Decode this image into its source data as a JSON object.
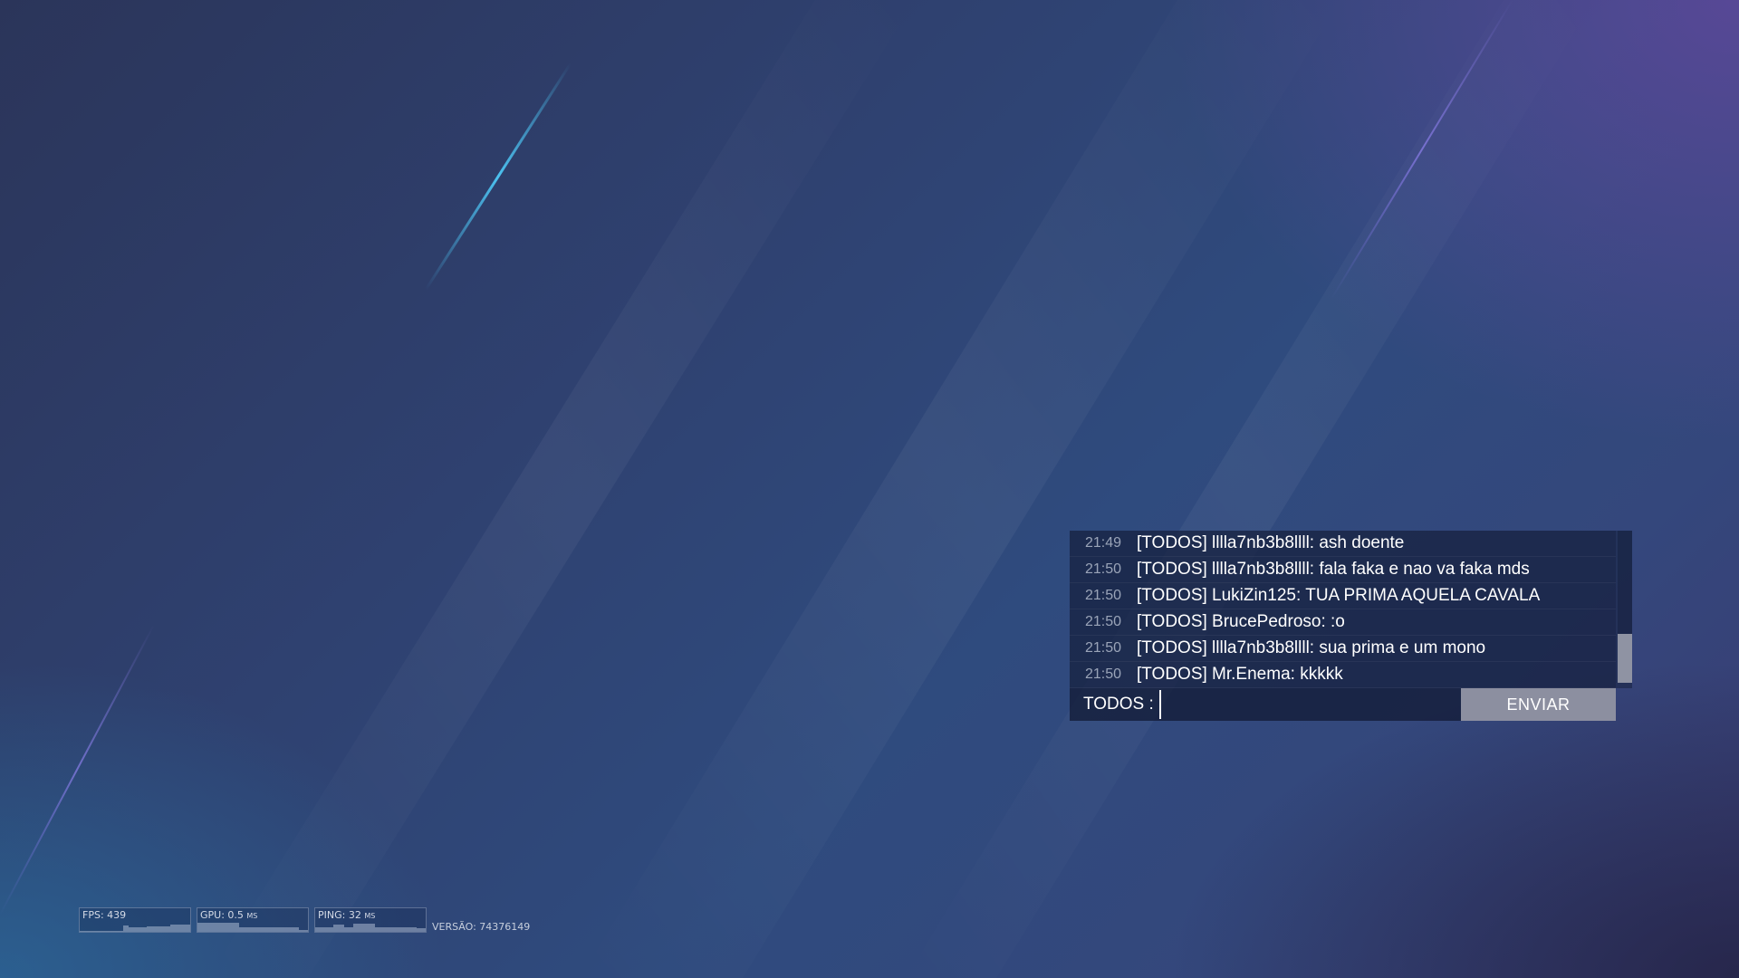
{
  "chat": {
    "messages": [
      {
        "time": "21:49",
        "text": "[TODOS] lllla7nb3b8llll: ash doente"
      },
      {
        "time": "21:50",
        "text": "[TODOS] lllla7nb3b8llll: fala faka e nao va faka mds"
      },
      {
        "time": "21:50",
        "text": "[TODOS] LukiZin125: TUA PRIMA AQUELA CAVALA"
      },
      {
        "time": "21:50",
        "text": "[TODOS] BrucePedroso: :o"
      },
      {
        "time": "21:50",
        "text": "[TODOS] lllla7nb3b8llll: sua prima e um mono"
      },
      {
        "time": "21:50",
        "text": "[TODOS] Mr.Enema: kkkkk"
      }
    ],
    "channel_label": "TODOS :",
    "input_value": "",
    "send_label": "ENVIAR",
    "scroll_position": 1.0
  },
  "hud": {
    "fps_label": "FPS: 439",
    "gpu_label": "GPU: 0.5",
    "gpu_unit": "MS",
    "ping_label": "PING: 32",
    "ping_unit": "MS",
    "version_label": "VERSÃO: 74376149"
  }
}
